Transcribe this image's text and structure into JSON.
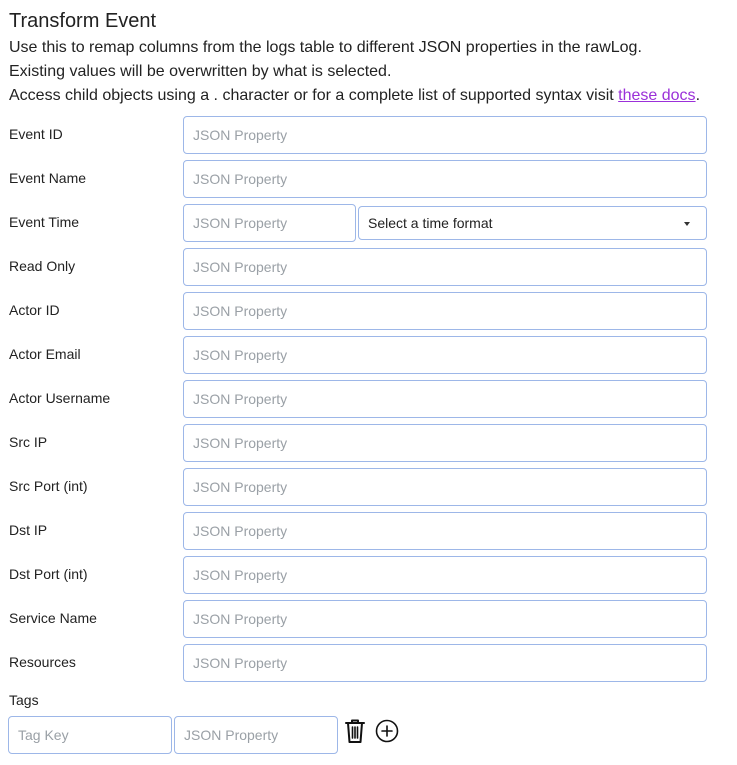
{
  "header": {
    "title": "Transform Event",
    "line1": "Use this to remap columns from the logs table to different JSON properties in the rawLog.",
    "line2": "Existing values will be overwritten by what is selected.",
    "line3_prefix": "Access child objects using a . character or for a complete list of supported syntax visit ",
    "line3_link": "these docs",
    "line3_suffix": "."
  },
  "fields": [
    {
      "label": "Event ID",
      "placeholder": "JSON Property",
      "value": ""
    },
    {
      "label": "Event Name",
      "placeholder": "JSON Property",
      "value": ""
    },
    {
      "label": "Event Time",
      "placeholder": "JSON Property",
      "value": "",
      "time_format_label": "Select a time format"
    },
    {
      "label": "Read Only",
      "placeholder": "JSON Property",
      "value": ""
    },
    {
      "label": "Actor ID",
      "placeholder": "JSON Property",
      "value": ""
    },
    {
      "label": "Actor Email",
      "placeholder": "JSON Property",
      "value": ""
    },
    {
      "label": "Actor Username",
      "placeholder": "JSON Property",
      "value": ""
    },
    {
      "label": "Src IP",
      "placeholder": "JSON Property",
      "value": ""
    },
    {
      "label": "Src Port (int)",
      "placeholder": "JSON Property",
      "value": ""
    },
    {
      "label": "Dst IP",
      "placeholder": "JSON Property",
      "value": ""
    },
    {
      "label": "Dst Port (int)",
      "placeholder": "JSON Property",
      "value": ""
    },
    {
      "label": "Service Name",
      "placeholder": "JSON Property",
      "value": ""
    },
    {
      "label": "Resources",
      "placeholder": "JSON Property",
      "value": ""
    }
  ],
  "tags": {
    "label": "Tags",
    "key_placeholder": "Tag Key",
    "value_placeholder": "JSON Property",
    "delete_icon": "trash-icon",
    "add_icon": "plus-circle-icon"
  },
  "colors": {
    "border": "#9db7e8",
    "link": "#9b30d9"
  }
}
